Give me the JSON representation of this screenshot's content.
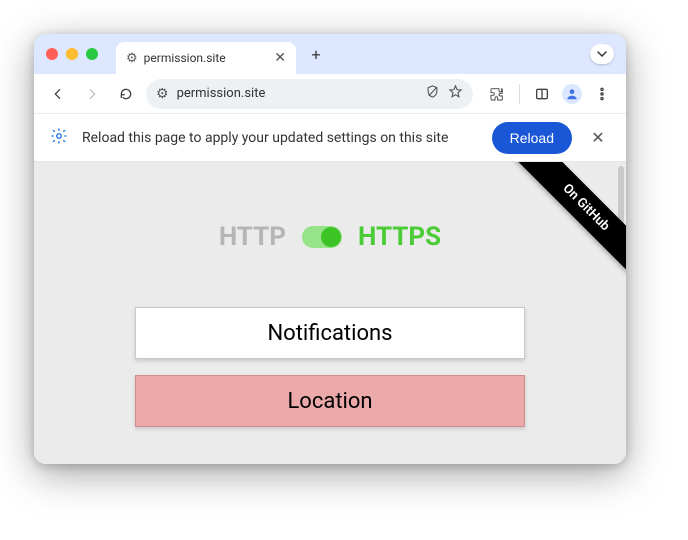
{
  "tab": {
    "title": "permission.site"
  },
  "omnibox": {
    "url": "permission.site"
  },
  "infobar": {
    "message": "Reload this page to apply your updated settings on this site",
    "reload_label": "Reload"
  },
  "ribbon": {
    "text": "On GitHub"
  },
  "protocol": {
    "off_label": "HTTP",
    "on_label": "HTTPS"
  },
  "buttons": {
    "notifications": "Notifications",
    "location": "Location"
  }
}
